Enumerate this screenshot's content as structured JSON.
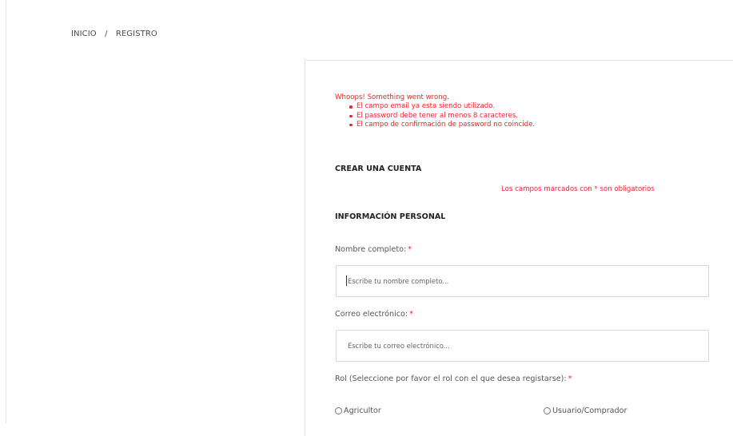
{
  "breadcrumb": {
    "home": "INICIO",
    "separator": "/",
    "current": "REGISTRO"
  },
  "alert": {
    "heading": "Whoops! Something went wrong.",
    "items": [
      "El campo email ya esta siendo utilizado.",
      "El password debe tener al menos 8 caracteres.",
      "El campo de confirmación de password no coincide."
    ],
    "color": "#e8262b"
  },
  "form": {
    "title": "CREAR UNA CUENTA",
    "required_note": "Los campos marcados con * son obligatorios",
    "section_personal": "INFORMACIÓN PERSONAL",
    "full_name": {
      "label": "Nombre completo:",
      "placeholder": "Escribe tu nombre completo...",
      "value": ""
    },
    "email": {
      "label": "Correo electrónico:",
      "placeholder": "Escribe tu correo electrónico...",
      "value": ""
    },
    "required_mark": "*",
    "role": {
      "label": "Rol (Seleccione por favor el rol con el que desea registarse):",
      "options": [
        "Agricultor",
        "Usuario/Comprador"
      ]
    }
  }
}
